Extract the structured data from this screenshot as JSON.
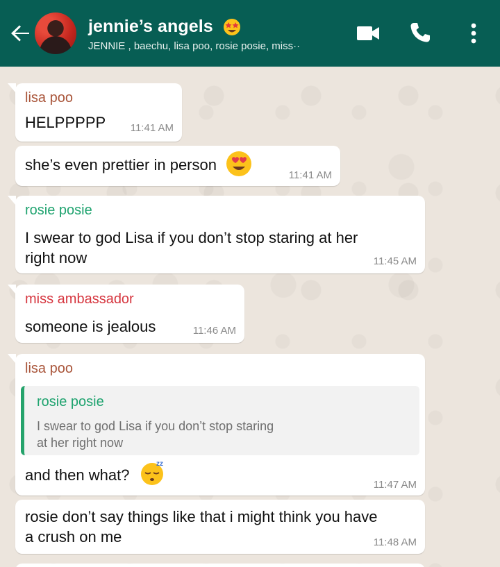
{
  "header": {
    "title": "jennie’s angels",
    "title_emoji": "star-struck-emoji",
    "participants": "JENNIE , baechu, lisa poo, rosie posie, miss··",
    "background": "#075e54"
  },
  "icons": [
    "back-arrow-icon",
    "video-call-icon",
    "phone-icon",
    "more-options-icon"
  ],
  "colors": {
    "lisa": "#a9553a",
    "rosie": "#1fa36f",
    "miss": "#d6363f",
    "chat_bg": "#ece5dd"
  },
  "messages": [
    {
      "sender": "lisa poo",
      "text": "HELPPPPP",
      "time": "11:41 AM"
    },
    {
      "text": "she’s even prettier in person",
      "emoji": "heart-eyes-emoji",
      "time": "11:41 AM"
    },
    {
      "sender": "rosie posie",
      "text_line1": "I swear to god Lisa if you don’t stop staring at her",
      "text_line2": "right now",
      "time": "11:45 AM"
    },
    {
      "sender": "miss ambassador",
      "text": "someone is jealous",
      "time": "11:46 AM"
    },
    {
      "sender": "lisa poo",
      "quote_name": "rosie posie",
      "quote_line1": "I swear to god Lisa if you don’t stop staring",
      "quote_line2": "at her right now",
      "text": "and then what?",
      "emoji": "sleeping-emoji",
      "time": "11:47 AM"
    },
    {
      "text_line1": "rosie don’t say things like that i might think you have",
      "text_line2": "a crush on me",
      "time": "11:48 AM"
    }
  ]
}
